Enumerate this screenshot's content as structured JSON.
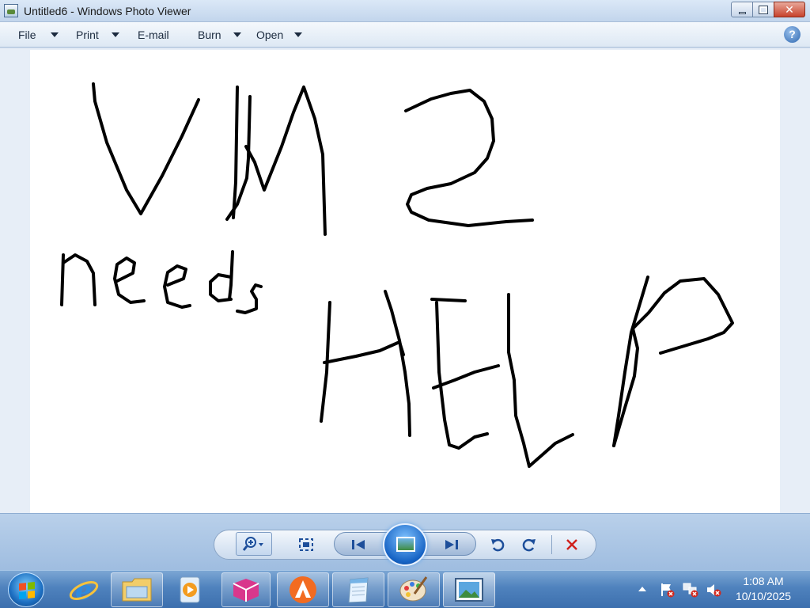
{
  "window": {
    "title": "Untitled6 - Windows Photo Viewer"
  },
  "menu": {
    "file": "File",
    "print": "Print",
    "email": "E-mail",
    "burn": "Burn",
    "open": "Open",
    "help": "?"
  },
  "taskbar": {
    "time": "1:08 AM",
    "date": "10/10/2025"
  },
  "icons": {
    "app": "photo-viewer-icon",
    "zoom": "magnifier-icon",
    "fit": "actual-size-icon",
    "previous": "previous-icon",
    "slideshow": "slideshow-icon",
    "next": "next-icon",
    "rotate_ccw": "rotate-counterclockwise-icon",
    "rotate_cw": "rotate-clockwise-icon",
    "delete": "delete-icon"
  }
}
